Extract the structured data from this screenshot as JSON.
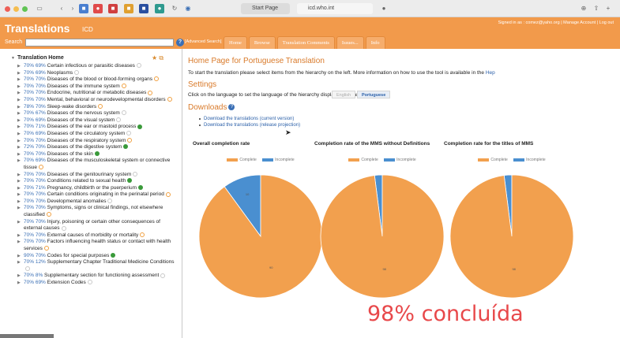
{
  "browser": {
    "tab_start": "Start Page",
    "tab_active": "icd.who.int"
  },
  "header": {
    "title": "Translations",
    "subtitle": "ICD",
    "right_links": "Signed in as : comez@yaho.org  |  Manage Account  |  Log out",
    "search_label": "Search",
    "search_value": "",
    "help_icon": "?",
    "advanced_search": "[Advanced Search]",
    "tabs": [
      "Home",
      "Browse",
      "Translation Comments",
      "Issues...",
      "Info"
    ]
  },
  "sidebar": {
    "heading": "Translation Home",
    "items": [
      {
        "p1": "70%",
        "p2": "69%",
        "label": "Certain infectious or parasitic diseases",
        "status": "grey"
      },
      {
        "p1": "70%",
        "p2": "69%",
        "label": "Neoplasms",
        "status": "grey"
      },
      {
        "p1": "70%",
        "p2": "70%",
        "label": "Diseases of the blood or blood-forming organs",
        "status": "orange"
      },
      {
        "p1": "70%",
        "p2": "70%",
        "label": "Diseases of the immune system",
        "status": "orange"
      },
      {
        "p1": "70%",
        "p2": "70%",
        "label": "Endocrine, nutritional or metabolic diseases",
        "status": "orange"
      },
      {
        "p1": "70%",
        "p2": "70%",
        "label": "Mental, behavioral or neurodevelopmental disorders",
        "status": "orange"
      },
      {
        "p1": "78%",
        "p2": "70%",
        "label": "Sleep-wake disorders",
        "status": "orange"
      },
      {
        "p1": "70%",
        "p2": "67%",
        "label": "Diseases of the nervous system",
        "status": "grey"
      },
      {
        "p1": "70%",
        "p2": "69%",
        "label": "Diseases of the visual system",
        "status": "grey"
      },
      {
        "p1": "70%",
        "p2": "71%",
        "label": "Diseases of the ear or mastoid process",
        "status": "green"
      },
      {
        "p1": "70%",
        "p2": "69%",
        "label": "Diseases of the circulatory system",
        "status": "grey"
      },
      {
        "p1": "70%",
        "p2": "70%",
        "label": "Diseases of the respiratory system",
        "status": "orange"
      },
      {
        "p1": "72%",
        "p2": "70%",
        "label": "Diseases of the digestive system",
        "status": "green"
      },
      {
        "p1": "70%",
        "p2": "70%",
        "label": "Diseases of the skin",
        "status": "green"
      },
      {
        "p1": "70%",
        "p2": "69%",
        "label": "Diseases of the musculoskeletal system or connective tissue",
        "status": "orange"
      },
      {
        "p1": "70%",
        "p2": "70%",
        "label": "Diseases of the genitourinary system",
        "status": "grey"
      },
      {
        "p1": "70%",
        "p2": "70%",
        "label": "Conditions related to sexual health",
        "status": "green"
      },
      {
        "p1": "70%",
        "p2": "71%",
        "label": "Pregnancy, childbirth or the puerperium",
        "status": "green"
      },
      {
        "p1": "70%",
        "p2": "70%",
        "label": "Certain conditions originating in the perinatal period",
        "status": "orange"
      },
      {
        "p1": "70%",
        "p2": "70%",
        "label": "Developmental anomalies",
        "status": "grey"
      },
      {
        "p1": "70%",
        "p2": "70%",
        "label": "Symptoms, signs or clinical findings, not elsewhere classified",
        "status": "orange"
      },
      {
        "p1": "70%",
        "p2": "70%",
        "label": "Injury, poisoning or certain other consequences of external causes",
        "status": "grey"
      },
      {
        "p1": "70%",
        "p2": "70%",
        "label": "External causes of morbidity or mortality",
        "status": "orange"
      },
      {
        "p1": "70%",
        "p2": "70%",
        "label": "Factors influencing health status or contact with health services",
        "status": "orange"
      },
      {
        "p1": "90%",
        "p2": "70%",
        "label": "Codes for special purposes",
        "status": "green"
      },
      {
        "p1": "70%",
        "p2": "12%",
        "label": "Supplementary Chapter Traditional Medicine Conditions",
        "status": "grey"
      },
      {
        "p1": "70%",
        "p2": "8%",
        "label": "Supplementary section for functioning assessment",
        "status": "grey"
      },
      {
        "p1": "70%",
        "p2": "69%",
        "label": "Extension Codes",
        "status": "grey"
      }
    ]
  },
  "main": {
    "title": "Home Page for Portuguese Translation",
    "intro": "To start the translation please select items from the hierarchy on the left. More information on how to use the tool is available in the",
    "intro_link": "Hep",
    "settings_title": "Settings",
    "settings_text": "Click on the language to set the language of the hierarchy display and searching:",
    "lang_english": "English",
    "lang_portuguese": "Portuguese",
    "downloads_title": "Downloads",
    "download_links": [
      "Download the translations (current version)",
      "Download the translations (release projection)"
    ]
  },
  "colors": {
    "orange_header": "#f29a4b",
    "pie_complete": "#f2a04e",
    "pie_incomplete": "#4a8fd0"
  },
  "chart_data": [
    {
      "type": "pie",
      "title": "Overall completion rate",
      "categories": [
        "Complete",
        "Incomplete"
      ],
      "values": [
        90,
        10
      ],
      "slice_labels": [
        "90",
        "10"
      ]
    },
    {
      "type": "pie",
      "title": "Completion rate of the MMS without Definitions",
      "categories": [
        "Complete",
        "Incomplete"
      ],
      "values": [
        98,
        2
      ],
      "slice_labels": [
        "98",
        ""
      ]
    },
    {
      "type": "pie",
      "title": "Completion rate for the titles of MMS",
      "categories": [
        "Complete",
        "Incomplete"
      ],
      "values": [
        98,
        2
      ],
      "slice_labels": [
        "98",
        ""
      ]
    }
  ],
  "overlay_caption": "98% concluída"
}
